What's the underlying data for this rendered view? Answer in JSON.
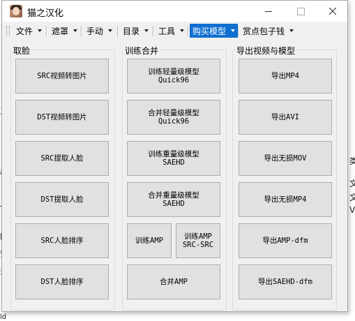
{
  "window": {
    "title": "猫之汉化"
  },
  "menu": [
    {
      "label": "文件",
      "active": false
    },
    {
      "label": "遮罩",
      "active": false
    },
    {
      "label": "手动",
      "active": false
    },
    {
      "label": "目录",
      "active": false
    },
    {
      "label": "工具",
      "active": false
    },
    {
      "label": "购买模型",
      "active": true
    },
    {
      "label": "赏点包子钱",
      "active": false
    }
  ],
  "groups": {
    "face": {
      "title": "取脸",
      "buttons": [
        {
          "line1": "SRC视频转图片"
        },
        {
          "line1": "DST视频转图片"
        },
        {
          "line1": "SRC提取人脸"
        },
        {
          "line1": "DST提取人脸"
        },
        {
          "line1": "SRC人脸排序"
        },
        {
          "line1": "DST人脸排序"
        }
      ]
    },
    "train": {
      "title": "训练合并",
      "buttons": [
        {
          "line1": "训练轻量级模型",
          "line2": "Quick96"
        },
        {
          "line1": "合并轻量级模型",
          "line2": "Quick96"
        },
        {
          "line1": "训练重量级模型",
          "line2": "SAEHD"
        },
        {
          "line1": "合并重量级模型",
          "line2": "SAEHD"
        },
        {
          "line1": "训练AMP"
        },
        {
          "line1": "训练AMP",
          "line2": "SRC-SRC"
        },
        {
          "line1": "合并AMP"
        }
      ]
    },
    "export": {
      "title": "导出视频与模型",
      "buttons": [
        {
          "line1": "导出MP4"
        },
        {
          "line1": "导出AVI"
        },
        {
          "line1": "导出无损MOV"
        },
        {
          "line1": "导出无损MP4"
        },
        {
          "line1": "导出AMP-dfm"
        },
        {
          "line1": "导出SAEHD-dfm"
        }
      ]
    }
  },
  "background_fragments": [
    "三",
    "后",
    "_n",
    "pi",
    "安",
    "录",
    "ld",
    "类",
    "文",
    "文",
    "V"
  ]
}
